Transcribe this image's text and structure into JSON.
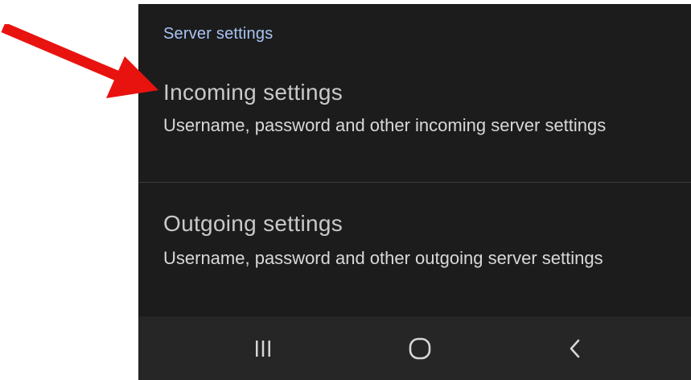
{
  "screen": {
    "section_header": "Server settings",
    "items": [
      {
        "title": "Incoming settings",
        "description": "Username, password and other incoming server settings"
      },
      {
        "title": "Outgoing settings",
        "description": "Username, password and other outgoing server settings"
      }
    ]
  },
  "navbar": {
    "buttons": [
      "recent-apps-icon",
      "home-icon",
      "back-icon"
    ]
  },
  "annotation": {
    "arrow_color": "#e8130f",
    "points_to": "incoming-settings"
  },
  "colors": {
    "background": "#1c1c1c",
    "header_accent": "#a9c4f5",
    "title_text": "#c9c9c9",
    "desc_text": "#d8d8d8",
    "navbar": "#262626"
  }
}
